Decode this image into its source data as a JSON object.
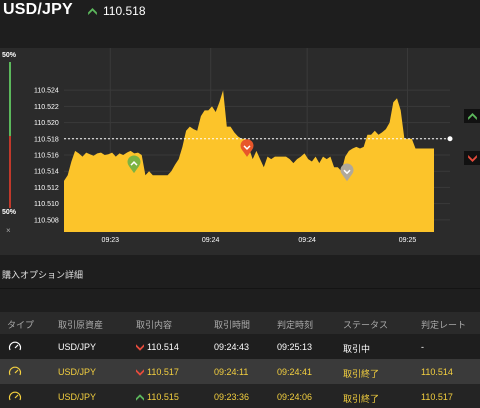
{
  "header": {
    "pair": "USD/JPY",
    "price": "110.518"
  },
  "meter": {
    "top_label": "50%",
    "bottom_label": "50%",
    "close_glyph": "×",
    "colors": {
      "up": "#5cb85c",
      "down": "#c0392b"
    }
  },
  "chart_data": {
    "type": "area",
    "title": "",
    "xlabel": "",
    "ylabel": "",
    "ylim": [
      110.5065,
      110.5255
    ],
    "yticks": [
      110.508,
      110.51,
      110.512,
      110.514,
      110.516,
      110.518,
      110.52,
      110.522,
      110.524
    ],
    "ytick_labels": [
      "110.508",
      "110.510",
      "110.512",
      "110.514",
      "110.516",
      "110.518",
      "110.520",
      "110.522",
      "110.524"
    ],
    "xtick_labels": [
      "09:23",
      "09:24",
      "09:24",
      "09:25"
    ],
    "xtick_fracs": [
      0.12,
      0.38,
      0.63,
      0.89
    ],
    "current_price": 110.518,
    "fill_color": "#fcc42a",
    "background": "#2b2b2b",
    "grid": true,
    "series": [
      {
        "values": [
          110.5128,
          110.5135,
          110.5152,
          110.5165,
          110.5162,
          110.5158,
          110.5163,
          110.5161,
          110.5159,
          110.5162,
          110.5163,
          110.516,
          110.5161,
          110.5163,
          110.5158,
          110.5162,
          110.516,
          110.5163,
          110.5165,
          110.5162,
          110.5163,
          110.516,
          110.5135,
          110.514,
          110.5135,
          110.5135,
          110.5135,
          110.5135,
          110.5135,
          110.514,
          110.5148,
          110.5155,
          110.517,
          110.519,
          110.5195,
          110.5192,
          110.519,
          110.5208,
          110.5215,
          110.5215,
          110.522,
          110.5213,
          110.5225,
          110.524,
          110.5195,
          110.5195,
          110.5188,
          110.5183,
          110.518,
          110.518,
          110.5168,
          110.5155,
          110.5165,
          110.5155,
          110.5145,
          110.5158,
          110.5155,
          110.5158,
          110.5158,
          110.5158,
          110.5158,
          110.5155,
          110.515,
          110.5155,
          110.5158,
          110.5162,
          110.5155,
          110.5152,
          110.5158,
          110.515,
          110.5158,
          110.5155,
          110.5158,
          110.5145,
          110.5145,
          110.514,
          110.5158,
          110.5165,
          110.5168,
          110.517,
          110.5168,
          110.517,
          110.5185,
          110.5185,
          110.519,
          110.5185,
          110.5188,
          110.5192,
          110.52,
          110.5225,
          110.523,
          110.5215,
          110.518,
          110.518,
          110.518,
          110.5168,
          110.5168,
          110.5168,
          110.5168,
          110.5168,
          110.5168
        ]
      }
    ],
    "markers": [
      {
        "type": "up",
        "price": 110.515,
        "color": "#7cb342"
      },
      {
        "type": "down",
        "price": 110.517,
        "color": "#e8562a"
      },
      {
        "type": "down",
        "price": 110.514,
        "color": "#b0a89a"
      }
    ]
  },
  "section": {
    "title": "購入オプション詳細"
  },
  "table": {
    "columns": [
      "タイプ",
      "取引原資産",
      "取引内容",
      "取引時間",
      "判定時刻",
      "ステータス",
      "判定レート"
    ],
    "rows": [
      {
        "asset": "USD/JPY",
        "direction": "down",
        "content": "110.514",
        "time": "09:24:43",
        "judge_time": "09:25:13",
        "status": "取引中",
        "rate": "-"
      },
      {
        "asset": "USD/JPY",
        "direction": "down",
        "content": "110.517",
        "time": "09:24:11",
        "judge_time": "09:24:41",
        "status": "取引終了",
        "rate": "110.514"
      },
      {
        "asset": "USD/JPY",
        "direction": "up",
        "content": "110.515",
        "time": "09:23:36",
        "judge_time": "09:24:06",
        "status": "取引終了",
        "rate": "110.517"
      }
    ]
  },
  "side_buttons": {
    "up_color": "#5cb85c",
    "down_color": "#e74c3c"
  }
}
